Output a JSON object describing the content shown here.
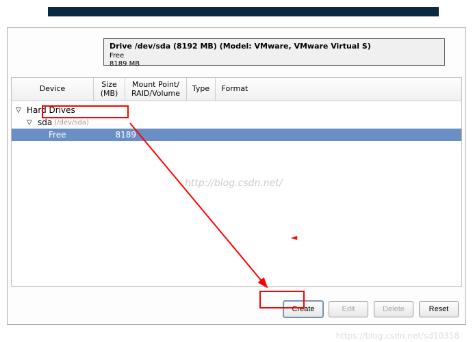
{
  "drive": {
    "title": "Drive /dev/sda (8192 MB) (Model: VMware, VMware Virtual S)",
    "free_label": "Free",
    "free_size": "8189 MB"
  },
  "columns": {
    "device": "Device",
    "size": "Size\n(MB)",
    "mount": "Mount Point/\nRAID/Volume",
    "type": "Type",
    "format": "Format"
  },
  "tree": {
    "root": "Hard Drives",
    "sda": "sda",
    "sda_path": "(/dev/sda)",
    "free_label": "Free",
    "free_size": "8189"
  },
  "buttons": {
    "create": "Create",
    "edit": "Edit",
    "delete": "Delete",
    "reset": "Reset"
  },
  "watermark": "http://blog.csdn.net/",
  "watermark2": "https://blog.csdn.net/sd10358"
}
